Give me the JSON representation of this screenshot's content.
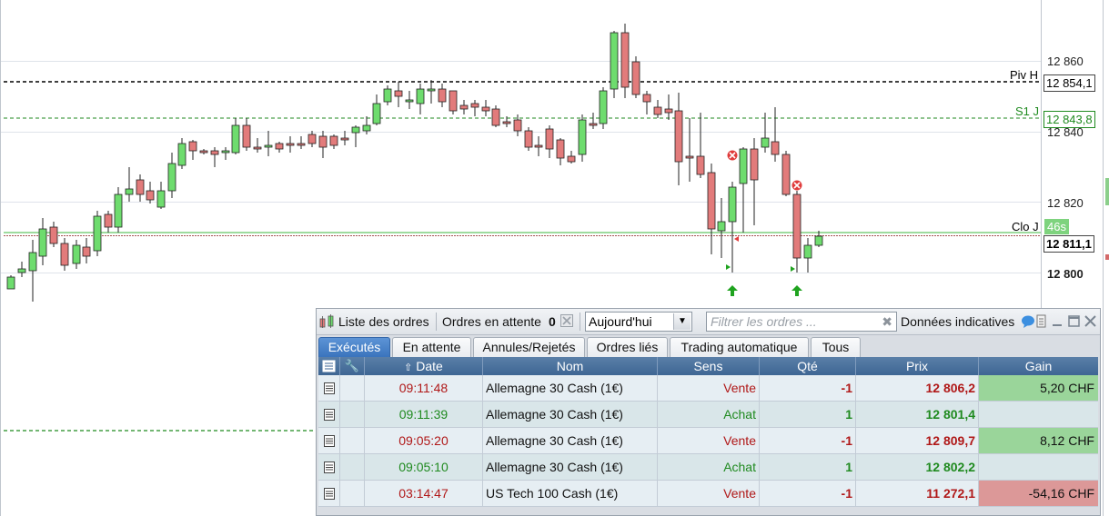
{
  "chart": {
    "price_labels": [
      "12 860",
      "12 840",
      "12 820",
      "12 800"
    ],
    "levels": [
      {
        "name": "Piv H",
        "value": "12 854,1",
        "color": "#000000"
      },
      {
        "name": "S1 J",
        "value": "12 843,8",
        "color": "#1f8a1f"
      },
      {
        "name": "Clo J",
        "value": "46s",
        "color": "#1f8a1f"
      }
    ],
    "current_price": "12 811,1",
    "colors": {
      "up": "#6edc6e",
      "down": "#e27b7b",
      "outline": "#222222",
      "support": "#1f8a1f"
    }
  },
  "orders_panel": {
    "title": "Liste des ordres",
    "pending_label": "Ordres en attente",
    "pending_count": "0",
    "period_value": "Aujourd'hui",
    "filter_placeholder": "Filtrer les ordres ...",
    "indicative_label": "Données indicatives",
    "tabs": [
      "Exécutés",
      "En attente",
      "Annules/Rejetés",
      "Ordres liés",
      "Trading automatique",
      "Tous"
    ],
    "columns": [
      "Date",
      "Nom",
      "Sens",
      "Qté",
      "Prix",
      "Gain"
    ],
    "rows": [
      {
        "date": "09:11:48",
        "name": "Allemagne 30 Cash (1€)",
        "side": "Vente",
        "qty": "-1",
        "price": "12 806,2",
        "gain": "5,20 CHF",
        "gain_status": "positive"
      },
      {
        "date": "09:11:39",
        "name": "Allemagne 30 Cash (1€)",
        "side": "Achat",
        "qty": "1",
        "price": "12 801,4",
        "gain": "",
        "gain_status": "none"
      },
      {
        "date": "09:05:20",
        "name": "Allemagne 30 Cash (1€)",
        "side": "Vente",
        "qty": "-1",
        "price": "12 809,7",
        "gain": "8,12 CHF",
        "gain_status": "positive"
      },
      {
        "date": "09:05:10",
        "name": "Allemagne 30 Cash (1€)",
        "side": "Achat",
        "qty": "1",
        "price": "12 802,2",
        "gain": "",
        "gain_status": "none"
      },
      {
        "date": "03:14:47",
        "name": "US Tech 100 Cash (1€)",
        "side": "Vente",
        "qty": "-1",
        "price": "11 272,1",
        "gain": "-54,16 CHF",
        "gain_status": "negative"
      }
    ]
  }
}
